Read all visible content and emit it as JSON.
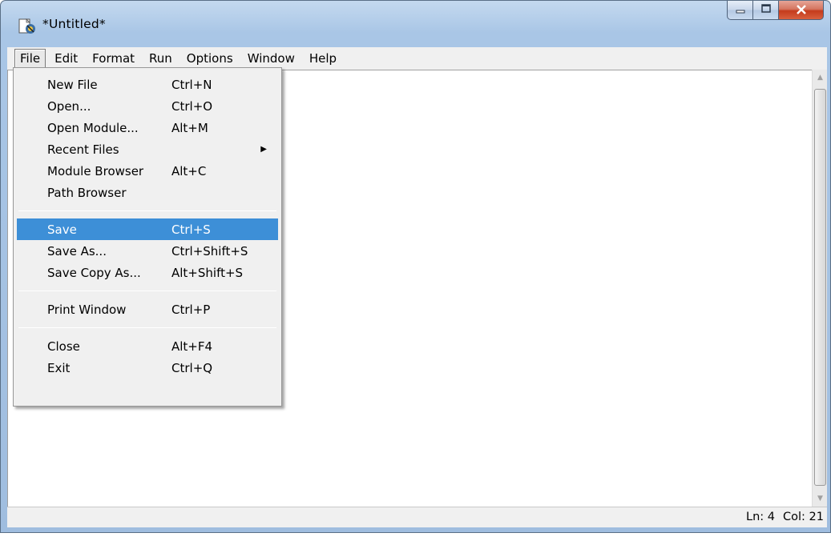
{
  "window": {
    "title": "*Untitled*",
    "icons": {
      "app": "python-idle-icon",
      "minimize": "minimize-icon",
      "maximize": "maximize-icon",
      "close": "close-icon"
    }
  },
  "menubar": {
    "items": [
      {
        "label": "File"
      },
      {
        "label": "Edit"
      },
      {
        "label": "Format"
      },
      {
        "label": "Run"
      },
      {
        "label": "Options"
      },
      {
        "label": "Window"
      },
      {
        "label": "Help"
      }
    ]
  },
  "file_menu": {
    "items": [
      {
        "label": "New File",
        "shortcut": "Ctrl+N"
      },
      {
        "label": "Open...",
        "shortcut": "Ctrl+O"
      },
      {
        "label": "Open Module...",
        "shortcut": "Alt+M"
      },
      {
        "label": "Recent Files",
        "shortcut": ""
      },
      {
        "label": "Module Browser",
        "shortcut": "Alt+C"
      },
      {
        "label": "Path Browser",
        "shortcut": ""
      },
      {
        "label": "Save",
        "shortcut": "Ctrl+S"
      },
      {
        "label": "Save As...",
        "shortcut": "Ctrl+Shift+S"
      },
      {
        "label": "Save Copy As...",
        "shortcut": "Alt+Shift+S"
      },
      {
        "label": "Print Window",
        "shortcut": "Ctrl+P"
      },
      {
        "label": "Close",
        "shortcut": "Alt+F4"
      },
      {
        "label": "Exit",
        "shortcut": "Ctrl+Q"
      }
    ]
  },
  "statusbar": {
    "line": "Ln: 4",
    "col": "Col: 21"
  },
  "colors": {
    "highlight": "#3d8fd7",
    "frame": "#a9c6e6",
    "close_button": "#c43b1c"
  }
}
